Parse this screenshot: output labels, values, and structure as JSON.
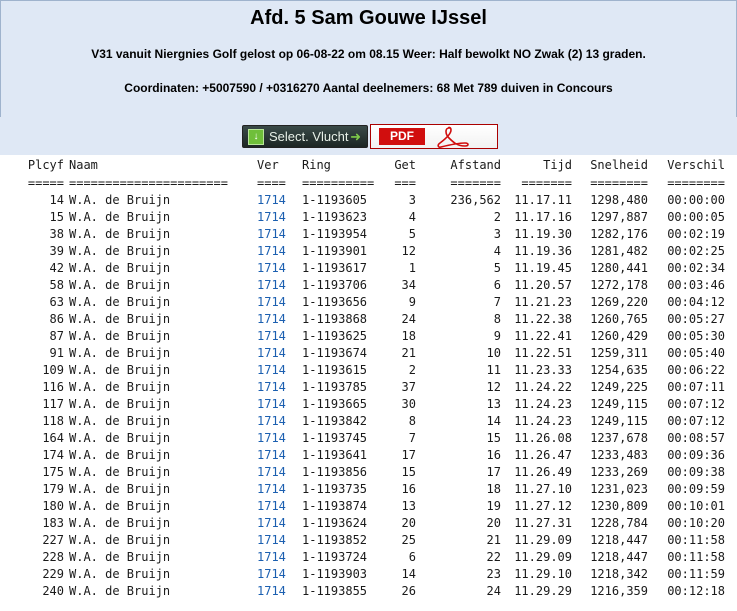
{
  "header": {
    "title": "Afd. 5 Sam Gouwe IJssel",
    "subtitle": "V31 vanuit Niergnies Golf gelost op 06-08-22 om 08.15 Weer: Half bewolkt NO Zwak (2) 13 graden.",
    "coords": "Coordinaten: +5007590 / +0316270 Aantal deelnemers: 68 Met 789 duiven in Concours"
  },
  "toolbar": {
    "select_label": "Select. Vlucht",
    "pdf_label": "PDF"
  },
  "table": {
    "headers": [
      "Plcyf",
      "Naam",
      "Ver",
      "Ring",
      "Get",
      "Afstand",
      "Tijd",
      "Snelheid",
      "Verschil"
    ],
    "separators": [
      "=====",
      "======================",
      "====",
      "==========",
      "===",
      "=======",
      "=======",
      "========",
      "========"
    ],
    "rows": [
      [
        "14",
        "W.A. de Bruijn",
        "1714",
        "1-1193605",
        "3",
        "236,562",
        "11.17.11",
        "1298,480",
        "00:00:00"
      ],
      [
        "15",
        "W.A. de Bruijn",
        "1714",
        "1-1193623",
        "4",
        "2",
        "11.17.16",
        "1297,887",
        "00:00:05"
      ],
      [
        "38",
        "W.A. de Bruijn",
        "1714",
        "1-1193954",
        "5",
        "3",
        "11.19.30",
        "1282,176",
        "00:02:19"
      ],
      [
        "39",
        "W.A. de Bruijn",
        "1714",
        "1-1193901",
        "12",
        "4",
        "11.19.36",
        "1281,482",
        "00:02:25"
      ],
      [
        "42",
        "W.A. de Bruijn",
        "1714",
        "1-1193617",
        "1",
        "5",
        "11.19.45",
        "1280,441",
        "00:02:34"
      ],
      [
        "58",
        "W.A. de Bruijn",
        "1714",
        "1-1193706",
        "34",
        "6",
        "11.20.57",
        "1272,178",
        "00:03:46"
      ],
      [
        "63",
        "W.A. de Bruijn",
        "1714",
        "1-1193656",
        "9",
        "7",
        "11.21.23",
        "1269,220",
        "00:04:12"
      ],
      [
        "86",
        "W.A. de Bruijn",
        "1714",
        "1-1193868",
        "24",
        "8",
        "11.22.38",
        "1260,765",
        "00:05:27"
      ],
      [
        "87",
        "W.A. de Bruijn",
        "1714",
        "1-1193625",
        "18",
        "9",
        "11.22.41",
        "1260,429",
        "00:05:30"
      ],
      [
        "91",
        "W.A. de Bruijn",
        "1714",
        "1-1193674",
        "21",
        "10",
        "11.22.51",
        "1259,311",
        "00:05:40"
      ],
      [
        "109",
        "W.A. de Bruijn",
        "1714",
        "1-1193615",
        "2",
        "11",
        "11.23.33",
        "1254,635",
        "00:06:22"
      ],
      [
        "116",
        "W.A. de Bruijn",
        "1714",
        "1-1193785",
        "37",
        "12",
        "11.24.22",
        "1249,225",
        "00:07:11"
      ],
      [
        "117",
        "W.A. de Bruijn",
        "1714",
        "1-1193665",
        "30",
        "13",
        "11.24.23",
        "1249,115",
        "00:07:12"
      ],
      [
        "118",
        "W.A. de Bruijn",
        "1714",
        "1-1193842",
        "8",
        "14",
        "11.24.23",
        "1249,115",
        "00:07:12"
      ],
      [
        "164",
        "W.A. de Bruijn",
        "1714",
        "1-1193745",
        "7",
        "15",
        "11.26.08",
        "1237,678",
        "00:08:57"
      ],
      [
        "174",
        "W.A. de Bruijn",
        "1714",
        "1-1193641",
        "17",
        "16",
        "11.26.47",
        "1233,483",
        "00:09:36"
      ],
      [
        "175",
        "W.A. de Bruijn",
        "1714",
        "1-1193856",
        "15",
        "17",
        "11.26.49",
        "1233,269",
        "00:09:38"
      ],
      [
        "179",
        "W.A. de Bruijn",
        "1714",
        "1-1193735",
        "16",
        "18",
        "11.27.10",
        "1231,023",
        "00:09:59"
      ],
      [
        "180",
        "W.A. de Bruijn",
        "1714",
        "1-1193874",
        "13",
        "19",
        "11.27.12",
        "1230,809",
        "00:10:01"
      ],
      [
        "183",
        "W.A. de Bruijn",
        "1714",
        "1-1193624",
        "20",
        "20",
        "11.27.31",
        "1228,784",
        "00:10:20"
      ],
      [
        "227",
        "W.A. de Bruijn",
        "1714",
        "1-1193852",
        "25",
        "21",
        "11.29.09",
        "1218,447",
        "00:11:58"
      ],
      [
        "228",
        "W.A. de Bruijn",
        "1714",
        "1-1193724",
        "6",
        "22",
        "11.29.09",
        "1218,447",
        "00:11:58"
      ],
      [
        "229",
        "W.A. de Bruijn",
        "1714",
        "1-1193903",
        "14",
        "23",
        "11.29.10",
        "1218,342",
        "00:11:59"
      ],
      [
        "240",
        "W.A. de Bruijn",
        "1714",
        "1-1193855",
        "26",
        "24",
        "11.29.29",
        "1216,359",
        "00:12:18"
      ]
    ]
  },
  "colors": {
    "header_bg": "#dfe8f5",
    "link": "#1b5fb0",
    "pdf_red": "#d10e0e"
  }
}
